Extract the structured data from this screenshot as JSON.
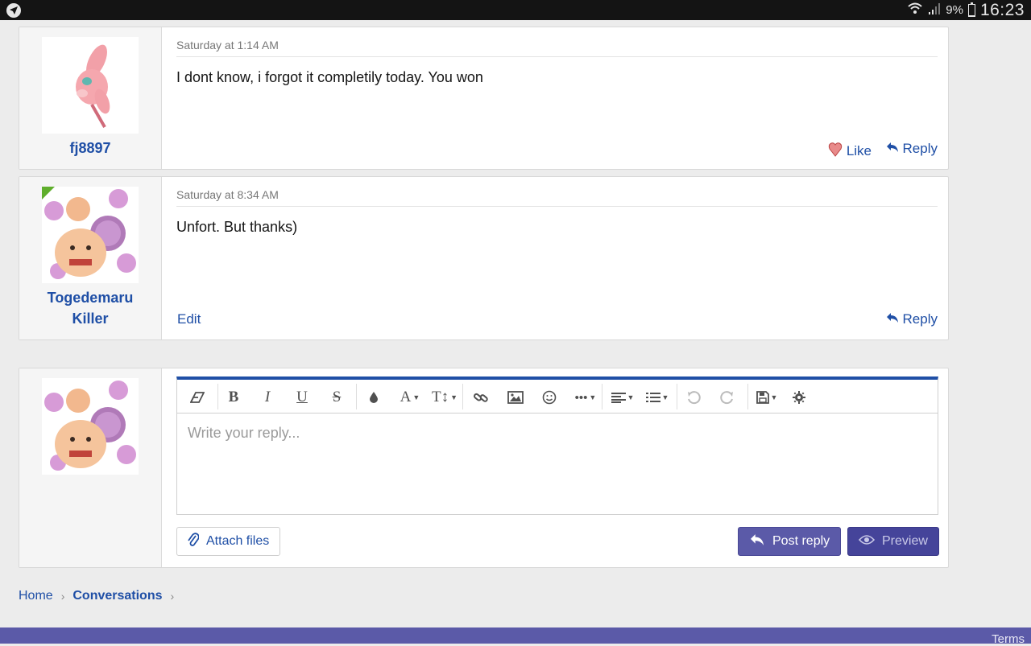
{
  "statusbar": {
    "battery": "9%",
    "time": "16:23",
    "icons": [
      "wifi-icon",
      "signal-icon",
      "battery-icon"
    ],
    "battery_level": 0.09
  },
  "messages": [
    {
      "username": "fj8897",
      "date": "Saturday at 1:14 AM",
      "text": "I dont know, i forgot it completily today. You won",
      "like_label": "Like",
      "reply_label": "Reply"
    },
    {
      "username_line1": "Togedemaru",
      "username_line2": "Killer",
      "date": "Saturday at 8:34 AM",
      "text": "Unfort. But thanks)",
      "edit_label": "Edit",
      "reply_label": "Reply"
    }
  ],
  "editor": {
    "placeholder": "Write your reply...",
    "attach_label": "Attach files",
    "post_label": "Post reply",
    "preview_label": "Preview",
    "toolbar_icons": [
      "eraser-icon",
      "bold-icon",
      "italic-icon",
      "underline-icon",
      "strikethrough-icon",
      "color-drop-icon",
      "font-family-icon",
      "font-size-icon",
      "link-icon",
      "image-icon",
      "smiley-icon",
      "more-icon",
      "align-icon",
      "list-icon",
      "undo-icon",
      "redo-icon",
      "save-drafts-icon",
      "settings-icon"
    ]
  },
  "breadcrumb": {
    "home": "Home",
    "conversations": "Conversations"
  },
  "footer": {
    "terms": "Terms"
  },
  "colors": {
    "accent": "#1f4fa6",
    "primary_button": "#5b5aa8",
    "online": "#5fae2c"
  }
}
